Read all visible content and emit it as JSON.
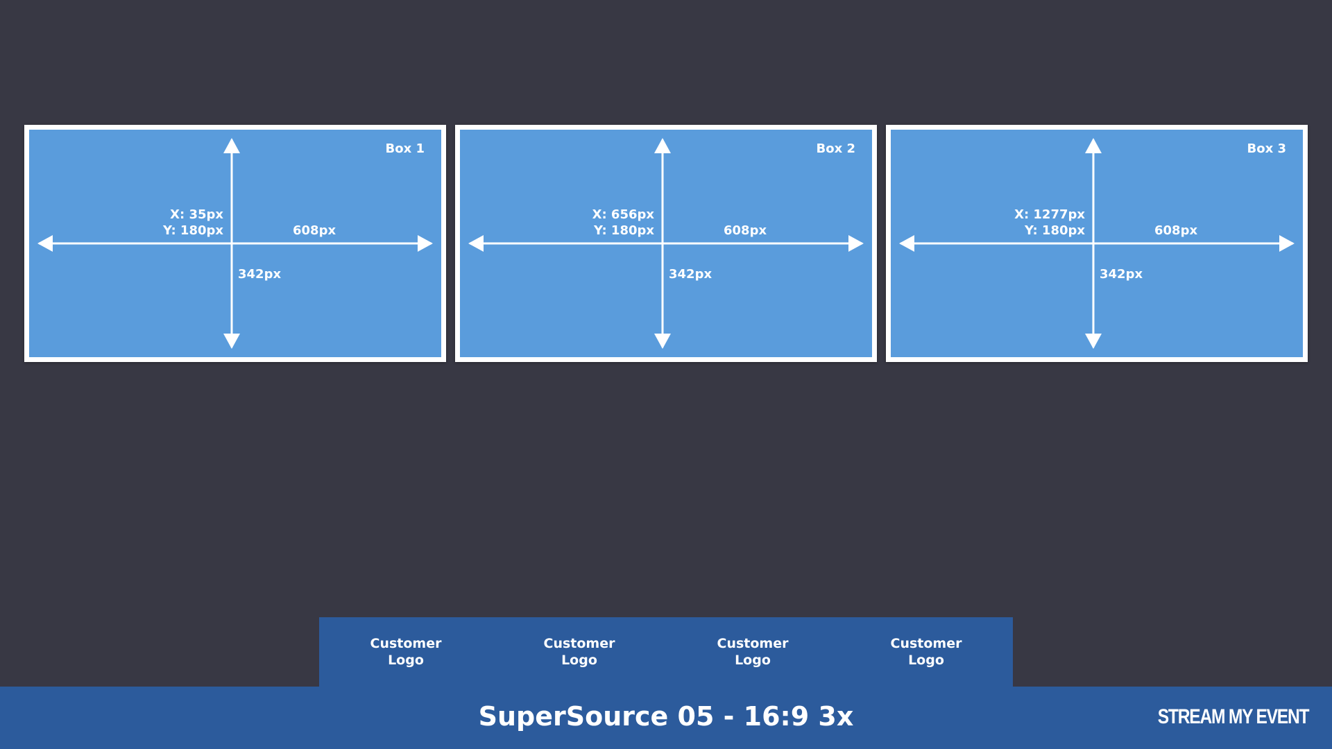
{
  "boxes": [
    {
      "title": "Box 1",
      "x_label": "X: 35px",
      "y_label": "Y: 180px",
      "width_label": "608px",
      "height_label": "342px"
    },
    {
      "title": "Box 2",
      "x_label": "X: 656px",
      "y_label": "Y: 180px",
      "width_label": "608px",
      "height_label": "342px"
    },
    {
      "title": "Box 3",
      "x_label": "X: 1277px",
      "y_label": "Y: 180px",
      "width_label": "608px",
      "height_label": "342px"
    }
  ],
  "logos": [
    {
      "line1": "Customer",
      "line2": "Logo"
    },
    {
      "line1": "Customer",
      "line2": "Logo"
    },
    {
      "line1": "Customer",
      "line2": "Logo"
    },
    {
      "line1": "Customer",
      "line2": "Logo"
    }
  ],
  "footer": {
    "title": "SuperSource 05 - 16:9 3x",
    "brand": "STREAM MY EVENT"
  },
  "colors": {
    "background": "#383844",
    "box_fill": "#5a9cdc",
    "box_border": "#ffffff",
    "bar": "#2c5b9c"
  }
}
